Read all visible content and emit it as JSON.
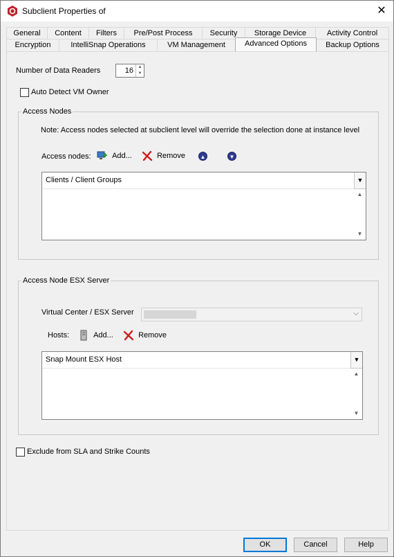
{
  "window": {
    "title": "Subclient Properties of",
    "close_symbol": "✕"
  },
  "tabs_row1": [
    "General",
    "Content",
    "Filters",
    "Pre/Post Process",
    "Security",
    "Storage Device",
    "Activity Control"
  ],
  "tabs_row2": [
    "Encryption",
    "IntelliSnap Operations",
    "VM Management",
    "Advanced Options",
    "Backup Options"
  ],
  "active_tab": "Advanced Options",
  "data_readers": {
    "label": "Number of Data Readers",
    "value": "16"
  },
  "auto_detect": {
    "label": "Auto Detect VM Owner",
    "checked": false
  },
  "access_nodes": {
    "legend": "Access Nodes",
    "note": "Note: Access nodes selected at subclient level will override the selection done at instance level",
    "label": "Access nodes:",
    "add": "Add...",
    "remove": "Remove",
    "list_header": "Clients / Client Groups"
  },
  "esx": {
    "legend": "Access Node ESX Server",
    "vc_label": "Virtual Center / ESX Server",
    "hosts_label": "Hosts:",
    "add": "Add...",
    "remove": "Remove",
    "list_header": "Snap Mount ESX Host"
  },
  "exclude_sla": {
    "label": "Exclude from SLA and Strike Counts",
    "checked": false
  },
  "buttons": {
    "ok": "OK",
    "cancel": "Cancel",
    "help": "Help"
  },
  "colors": {
    "accent": "#0078d7",
    "remove_red": "#d11a1a",
    "arrow_blue": "#2e3b8f",
    "logo_red": "#c0202a"
  }
}
